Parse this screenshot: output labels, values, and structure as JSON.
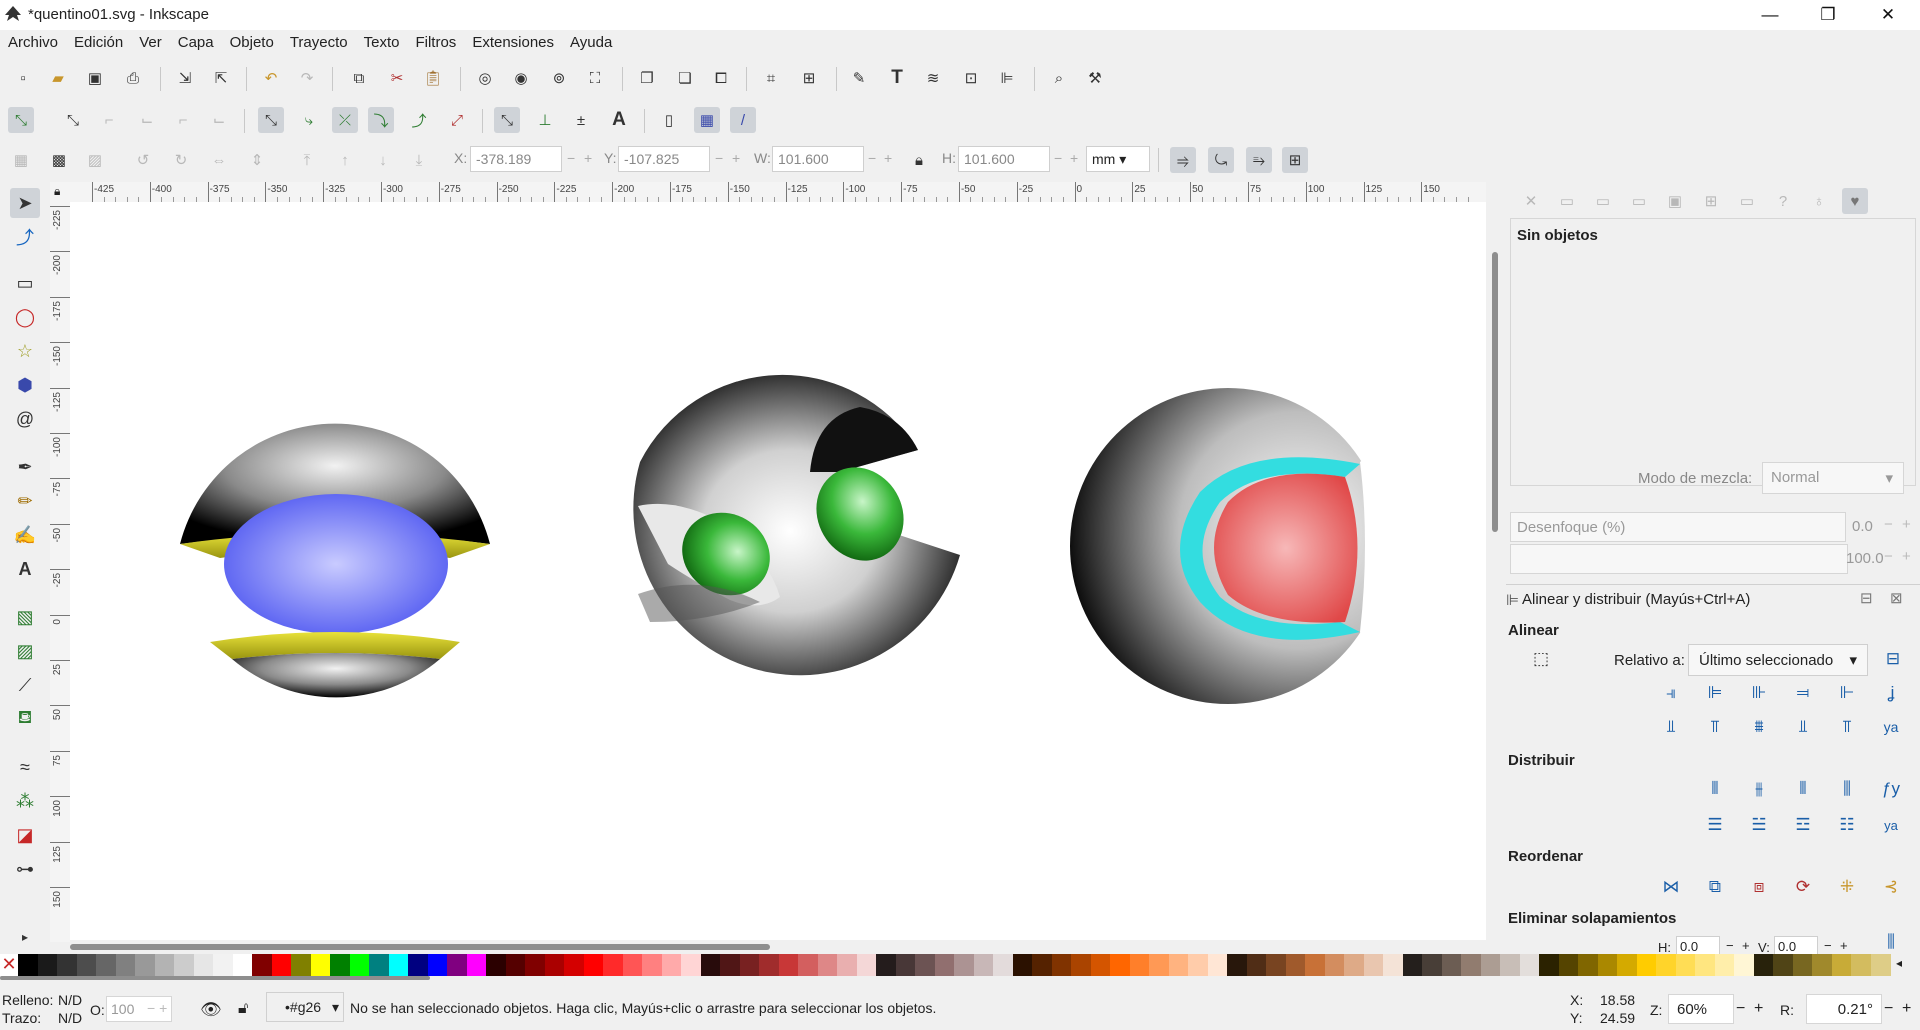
{
  "window": {
    "title": "*quentino01.svg - Inkscape",
    "minimize": "—",
    "maximize": "❐",
    "close": "✕"
  },
  "menu": [
    "Archivo",
    "Edición",
    "Ver",
    "Capa",
    "Objeto",
    "Trayecto",
    "Texto",
    "Filtros",
    "Extensiones",
    "Ayuda"
  ],
  "toolcontrols": {
    "x_label": "X:",
    "x_value": "-378.189",
    "y_label": "Y:",
    "y_value": "-107.825",
    "w_label": "W:",
    "w_value": "101.600",
    "h_label": "H:",
    "h_value": "101.600",
    "unit": "mm",
    "minus": "−",
    "plus": "+"
  },
  "hruler_ticks": [
    "-425",
    "-400",
    "-375",
    "-350",
    "-325",
    "-300",
    "-275",
    "-250",
    "-225",
    "-200",
    "-175",
    "-150",
    "-125",
    "-100",
    "-75",
    "-50",
    "-25",
    "0",
    "25",
    "50",
    "75",
    "100",
    "125",
    "150"
  ],
  "vruler_ticks": [
    "-225",
    "-200",
    "-175",
    "-150",
    "-125",
    "-100",
    "-75",
    "-50",
    "-25",
    "0",
    "25",
    "50",
    "75",
    "100",
    "125",
    "150"
  ],
  "right_panel": {
    "no_objects": "Sin objetos",
    "blend_label": "Modo de mezcla:",
    "blend_value": "Normal",
    "blur_label": "Desenfoque (%)",
    "blur_value": "0.0",
    "opacity_value": "100.0",
    "align_title": "Alinear y distribuir (Mayús+Ctrl+A)",
    "align_section": "Alinear",
    "relative_label": "Relativo a:",
    "relative_value": "Último seleccionado",
    "distribute_section": "Distribuir",
    "reorder_section": "Reordenar",
    "overlap_section": "Eliminar solapamientos",
    "h_label": "H:",
    "h_value": "0.0",
    "v_label": "V:",
    "v_value": "0.0"
  },
  "palette_colors": [
    "#000000",
    "#1a1a1a",
    "#333333",
    "#4d4d4d",
    "#666666",
    "#808080",
    "#999999",
    "#b3b3b3",
    "#cccccc",
    "#e6e6e6",
    "#f2f2f2",
    "#ffffff",
    "#800000",
    "#ff0000",
    "#808000",
    "#ffff00",
    "#008000",
    "#00ff00",
    "#008080",
    "#00ffff",
    "#000080",
    "#0000ff",
    "#800080",
    "#ff00ff",
    "#2b0000",
    "#550000",
    "#800000",
    "#aa0000",
    "#d40000",
    "#ff0000",
    "#ff2a2a",
    "#ff5555",
    "#ff8080",
    "#ffaaaa",
    "#ffd5d5",
    "#280b0b",
    "#501616",
    "#782121",
    "#a02c2c",
    "#c83737",
    "#d35f5f",
    "#de8787",
    "#e9afaf",
    "#f4d7d7",
    "#241c1c",
    "#483737",
    "#6c5353",
    "#916f6f",
    "#ac9393",
    "#c8b7b7",
    "#e3dbdb",
    "#2b1100",
    "#552200",
    "#803300",
    "#aa4400",
    "#d45500",
    "#ff6600",
    "#ff7f2a",
    "#ff9955",
    "#ffb380",
    "#ffccaa",
    "#ffe6d5",
    "#28170b",
    "#502d16",
    "#784421",
    "#a05a2c",
    "#c87137",
    "#d38d5f",
    "#deaa87",
    "#e9c6af",
    "#f4e3d7",
    "#241f1c",
    "#483e37",
    "#6c5d53",
    "#917c6f",
    "#ac9d93",
    "#c8beb7",
    "#e3dedb",
    "#2b2200",
    "#554400",
    "#806600",
    "#aa8800",
    "#d4aa00",
    "#ffcc00",
    "#ffd42a",
    "#ffdd55",
    "#ffe680",
    "#ffeeaa",
    "#fff6d5",
    "#28220b",
    "#504416",
    "#786721",
    "#a0892c",
    "#c8ab37",
    "#d3bc5f",
    "#decd87"
  ],
  "status": {
    "fill_label": "Relleno:",
    "fill_value": "N/D",
    "stroke_label": "Trazo:",
    "stroke_value": "N/D",
    "opacity_label": "O:",
    "opacity_value": "100",
    "layer": "•#g26",
    "message": "No se han seleccionado objetos. Haga clic, Mayús+clic o arrastre para seleccionar los objetos.",
    "x_label": "X:",
    "x_value": "18.58",
    "y_label": "Y:",
    "y_value": "24.59",
    "zoom_label": "Z:",
    "zoom_value": "60%",
    "rot_label": "R:",
    "rot_value": "0.21°",
    "minus": "−",
    "plus": "+"
  }
}
